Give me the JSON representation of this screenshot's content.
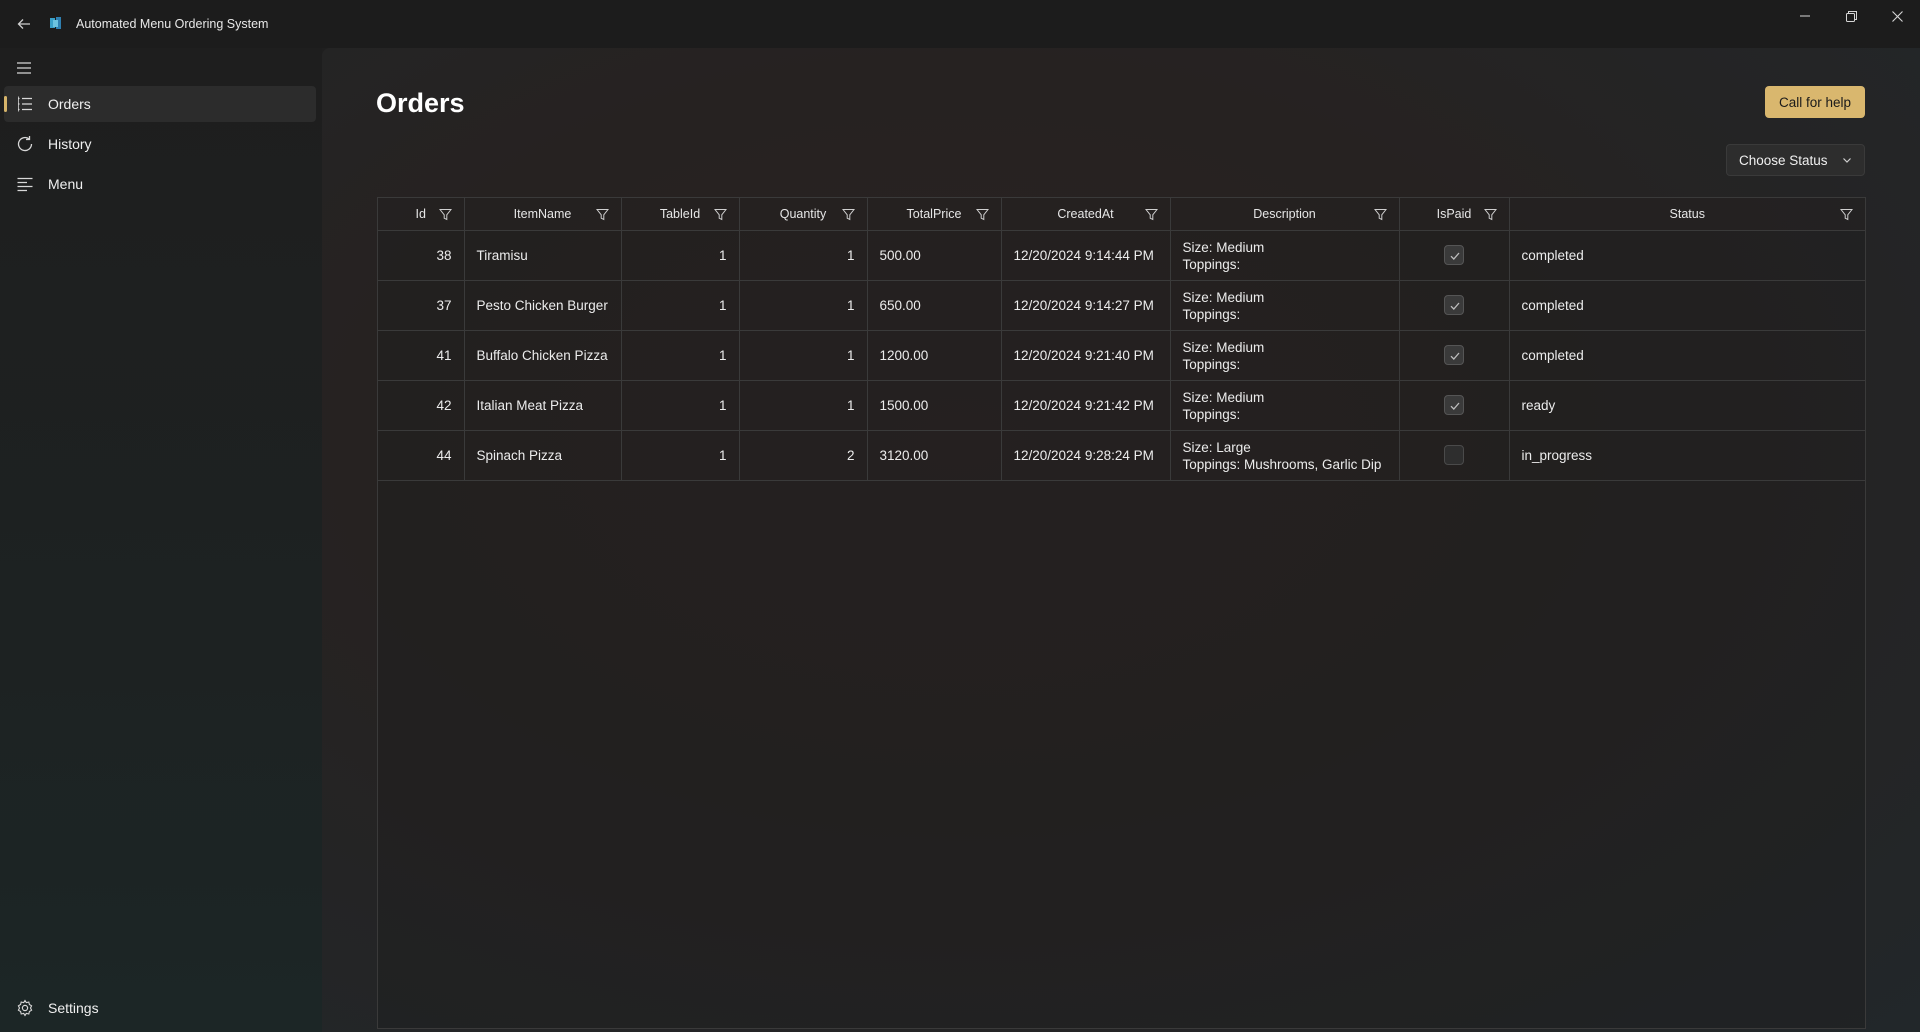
{
  "window": {
    "title": "Automated Menu Ordering System",
    "controls": {
      "minimize": "minimize-icon",
      "maximize": "restore-icon",
      "close": "close-icon"
    }
  },
  "sidebar": {
    "items": [
      {
        "label": "Orders",
        "icon": "list-icon",
        "active": true
      },
      {
        "label": "History",
        "icon": "refresh-icon",
        "active": false
      },
      {
        "label": "Menu",
        "icon": "menu-lines-icon",
        "active": false
      }
    ],
    "settings_label": "Settings"
  },
  "page": {
    "title": "Orders",
    "help_button": "Call for help",
    "status_dropdown": "Choose Status"
  },
  "colors": {
    "accent": "#d9b76e",
    "background": "#1f1f1f"
  },
  "grid": {
    "columns": [
      "Id",
      "ItemName",
      "TableId",
      "Quantity",
      "TotalPrice",
      "CreatedAt",
      "Description",
      "IsPaid",
      "Status"
    ],
    "rows": [
      {
        "id": "38",
        "item": "Tiramisu",
        "table": "1",
        "qty": "1",
        "price": "500.00",
        "created": "12/20/2024 9:14:44 PM",
        "desc1": "Size: Medium",
        "desc2": "Toppings:",
        "paid": true,
        "status": "completed"
      },
      {
        "id": "37",
        "item": "Pesto Chicken Burger",
        "table": "1",
        "qty": "1",
        "price": "650.00",
        "created": "12/20/2024 9:14:27 PM",
        "desc1": "Size: Medium",
        "desc2": "Toppings:",
        "paid": true,
        "status": "completed"
      },
      {
        "id": "41",
        "item": "Buffalo Chicken Pizza",
        "table": "1",
        "qty": "1",
        "price": "1200.00",
        "created": "12/20/2024 9:21:40 PM",
        "desc1": "Size: Medium",
        "desc2": "Toppings:",
        "paid": true,
        "status": "completed"
      },
      {
        "id": "42",
        "item": "Italian Meat Pizza",
        "table": "1",
        "qty": "1",
        "price": "1500.00",
        "created": "12/20/2024 9:21:42 PM",
        "desc1": "Size: Medium",
        "desc2": "Toppings:",
        "paid": true,
        "status": "ready"
      },
      {
        "id": "44",
        "item": "Spinach Pizza",
        "table": "1",
        "qty": "2",
        "price": "3120.00",
        "created": "12/20/2024 9:28:24 PM",
        "desc1": "Size: Large",
        "desc2": "Toppings: Mushrooms, Garlic Dip",
        "paid": false,
        "status": "in_progress"
      }
    ]
  }
}
